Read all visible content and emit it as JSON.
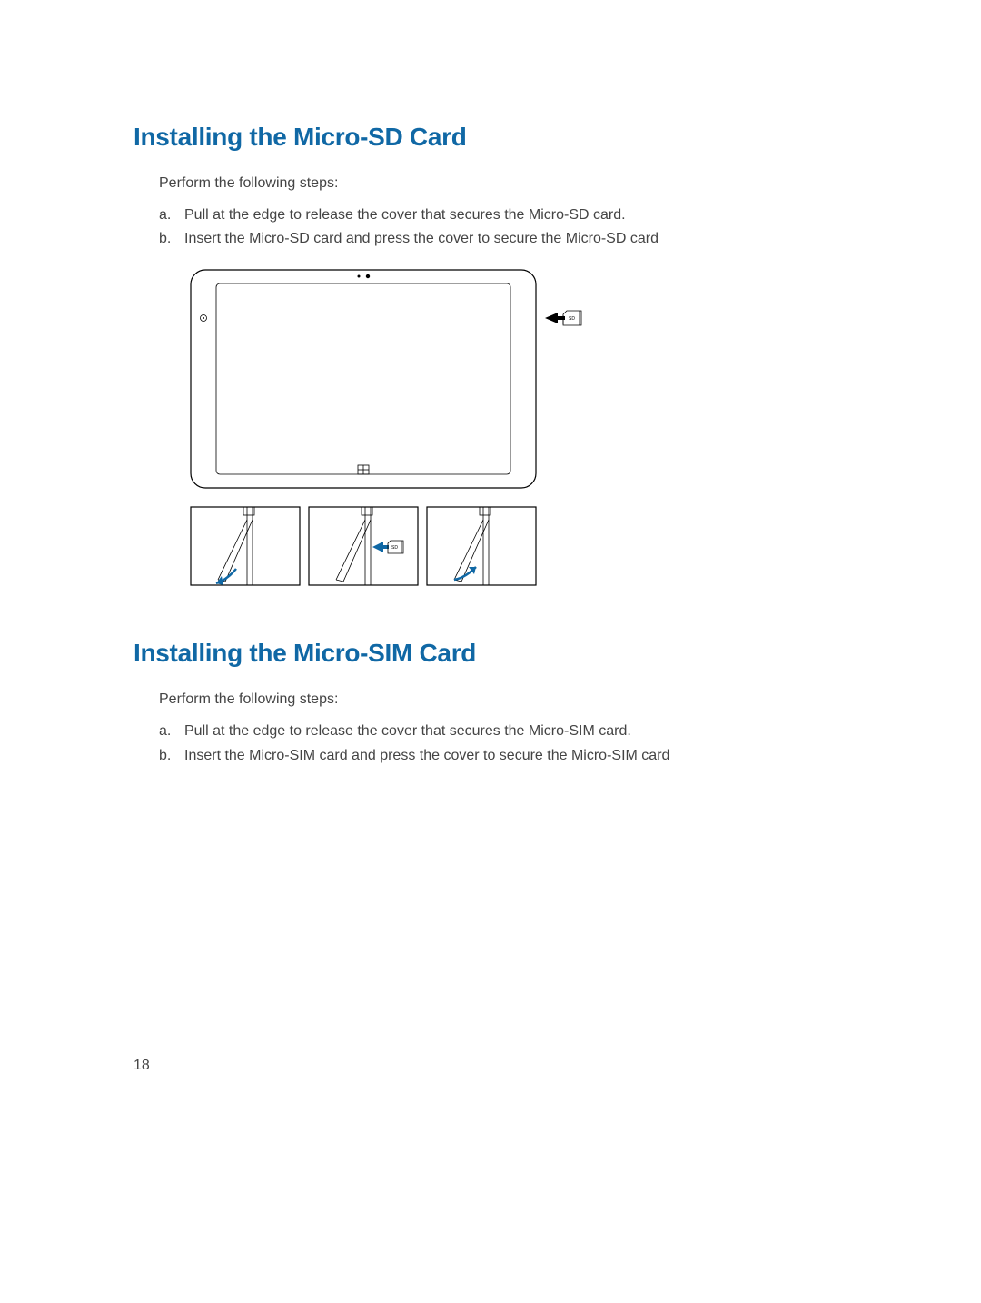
{
  "page_number": "18",
  "section1": {
    "heading": "Installing the Micro-SD Card",
    "intro": "Perform the following steps:",
    "steps": [
      {
        "marker": "a.",
        "text": "Pull at the edge to release the cover that secures the Micro-SD card."
      },
      {
        "marker": "b.",
        "text": "Insert the Micro-SD card and press the cover to secure the Micro-SD card"
      }
    ]
  },
  "section2": {
    "heading": "Installing the Micro-SIM Card",
    "intro": "Perform the following steps:",
    "steps": [
      {
        "marker": "a.",
        "text": "Pull at the edge to release the cover that secures the Micro-SIM card."
      },
      {
        "marker": "b.",
        "text": "Insert the Micro-SIM card and press the cover to secure the Micro-SIM card"
      }
    ]
  },
  "diagram": {
    "sd_label": "SD",
    "icons": {
      "sd_card": "sd-card-icon",
      "arrow_left": "arrow-left-icon",
      "arrow_curved": "arrow-curved-icon"
    }
  }
}
